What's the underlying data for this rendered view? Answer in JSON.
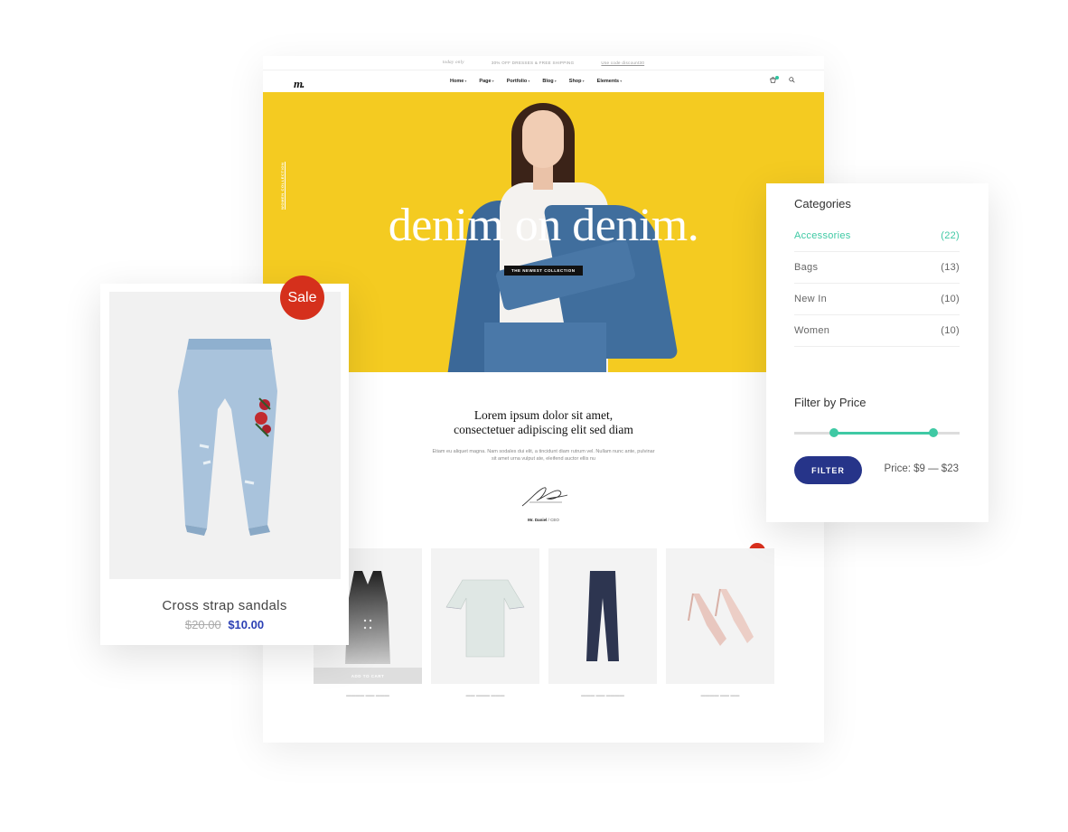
{
  "topbar": {
    "left": "today only",
    "center": "30% OFF DRESSES & FREE SHIPPING",
    "right": "Use code discount30"
  },
  "nav": {
    "logo": "m.",
    "menu": [
      "Home",
      "Page",
      "Portfolio",
      "Blog",
      "Shop",
      "Elements"
    ]
  },
  "hero": {
    "title": "denim on denim.",
    "tag": "THE NEWEST COLLECTION",
    "side_label": "WOMEN COLLECTION"
  },
  "intro": {
    "title_line1": "Lorem ipsum dolor sit amet,",
    "title_line2": "consectetuer adipiscing elit sed diam",
    "body": "Etiam eu aliquet magna. Nam sodales dui elit, a tincidunt diam rutrum vel. Nullam nunc ante, pulvinar sit amet urna vulput ate, eleifend auctor ellis nu",
    "signer_name": "Mr. Daniel",
    "signer_role": "/ CEO"
  },
  "products": {
    "add_to_cart": "ADD TO CART",
    "sale": "Sale"
  },
  "featured": {
    "badge": "Sale",
    "name": "Cross strap sandals",
    "old_price": "$20.00",
    "new_price": "$10.00"
  },
  "sidebar": {
    "categories_title": "Categories",
    "categories": [
      {
        "name": "Accessories",
        "count": "(22)",
        "active": true
      },
      {
        "name": "Bags",
        "count": "(13)"
      },
      {
        "name": "New In",
        "count": "(10)"
      },
      {
        "name": "Women",
        "count": "(10)"
      }
    ],
    "price_title": "Filter by Price",
    "filter_button": "FILTER",
    "price_range": "Price: $9 — $23",
    "slider_range_fraction": [
      0.24,
      0.84
    ]
  },
  "colors": {
    "hero_bg": "#f4cb21",
    "accent_green": "#3fc9a4",
    "button_navy": "#263489",
    "sale_red": "#d5301c"
  }
}
